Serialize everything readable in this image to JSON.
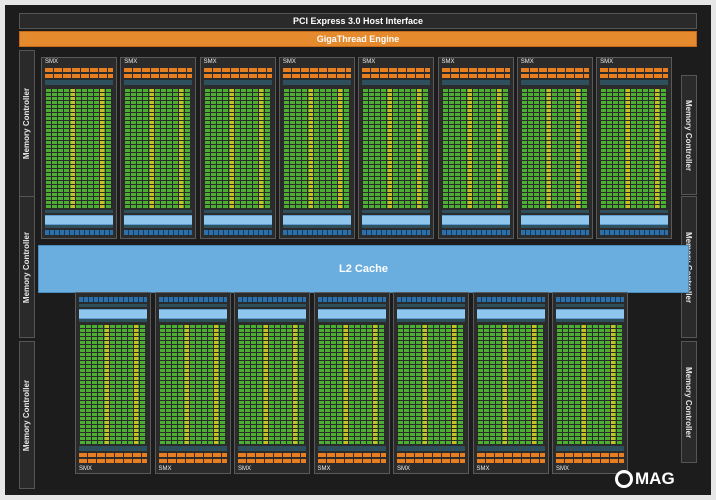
{
  "top_bar": "PCI Express 3.0 Host Interface",
  "engine_bar": "GigaThread Engine",
  "memory_controller_label": "Memory Controller",
  "l2_label": "L2 Cache",
  "smx_label": "SMX",
  "top_smx_count": 8,
  "bottom_smx_count": 7,
  "logo": "MAG",
  "colors": {
    "background": "#1c1c1c",
    "engine": "#e68a2e",
    "l2": "#6aaee0",
    "core_green": "#4caf32",
    "core_yellow": "#c8c020"
  }
}
